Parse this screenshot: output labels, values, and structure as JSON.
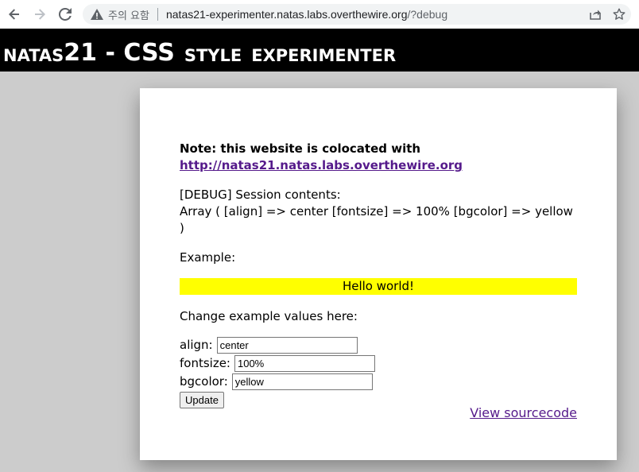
{
  "browser": {
    "security_label": "주의 요함",
    "url_host": "natas21-experimenter.natas.labs.overthewire.org",
    "url_path": "/?debug"
  },
  "header": {
    "natas": "NATAS",
    "num": "21",
    "dash": " - ",
    "css": "CSS",
    "style": "STYLE",
    "experimenter": "EXPERIMENTER"
  },
  "content": {
    "note": "Note: this website is colocated with",
    "note_link": "http://natas21.natas.labs.overthewire.org",
    "debug_line1": "[DEBUG] Session contents:",
    "debug_line2": "Array ( [align] => center [fontsize] => 100% [bgcolor] => yellow )",
    "example_label": "Example:",
    "hello_text": "Hello world!",
    "hello_bg": "#ffff00",
    "change_label": "Change example values here:",
    "form": {
      "align_label": "align:",
      "align_value": "center",
      "fontsize_label": "fontsize:",
      "fontsize_value": "100%",
      "bgcolor_label": "bgcolor:",
      "bgcolor_value": "yellow",
      "update_label": "Update"
    },
    "view_source": "View sourcecode"
  },
  "icons": {
    "back": "back-arrow-icon",
    "forward": "forward-arrow-icon",
    "reload": "reload-icon",
    "warning": "warning-triangle-icon",
    "share": "share-icon",
    "bookmark": "star-icon"
  }
}
